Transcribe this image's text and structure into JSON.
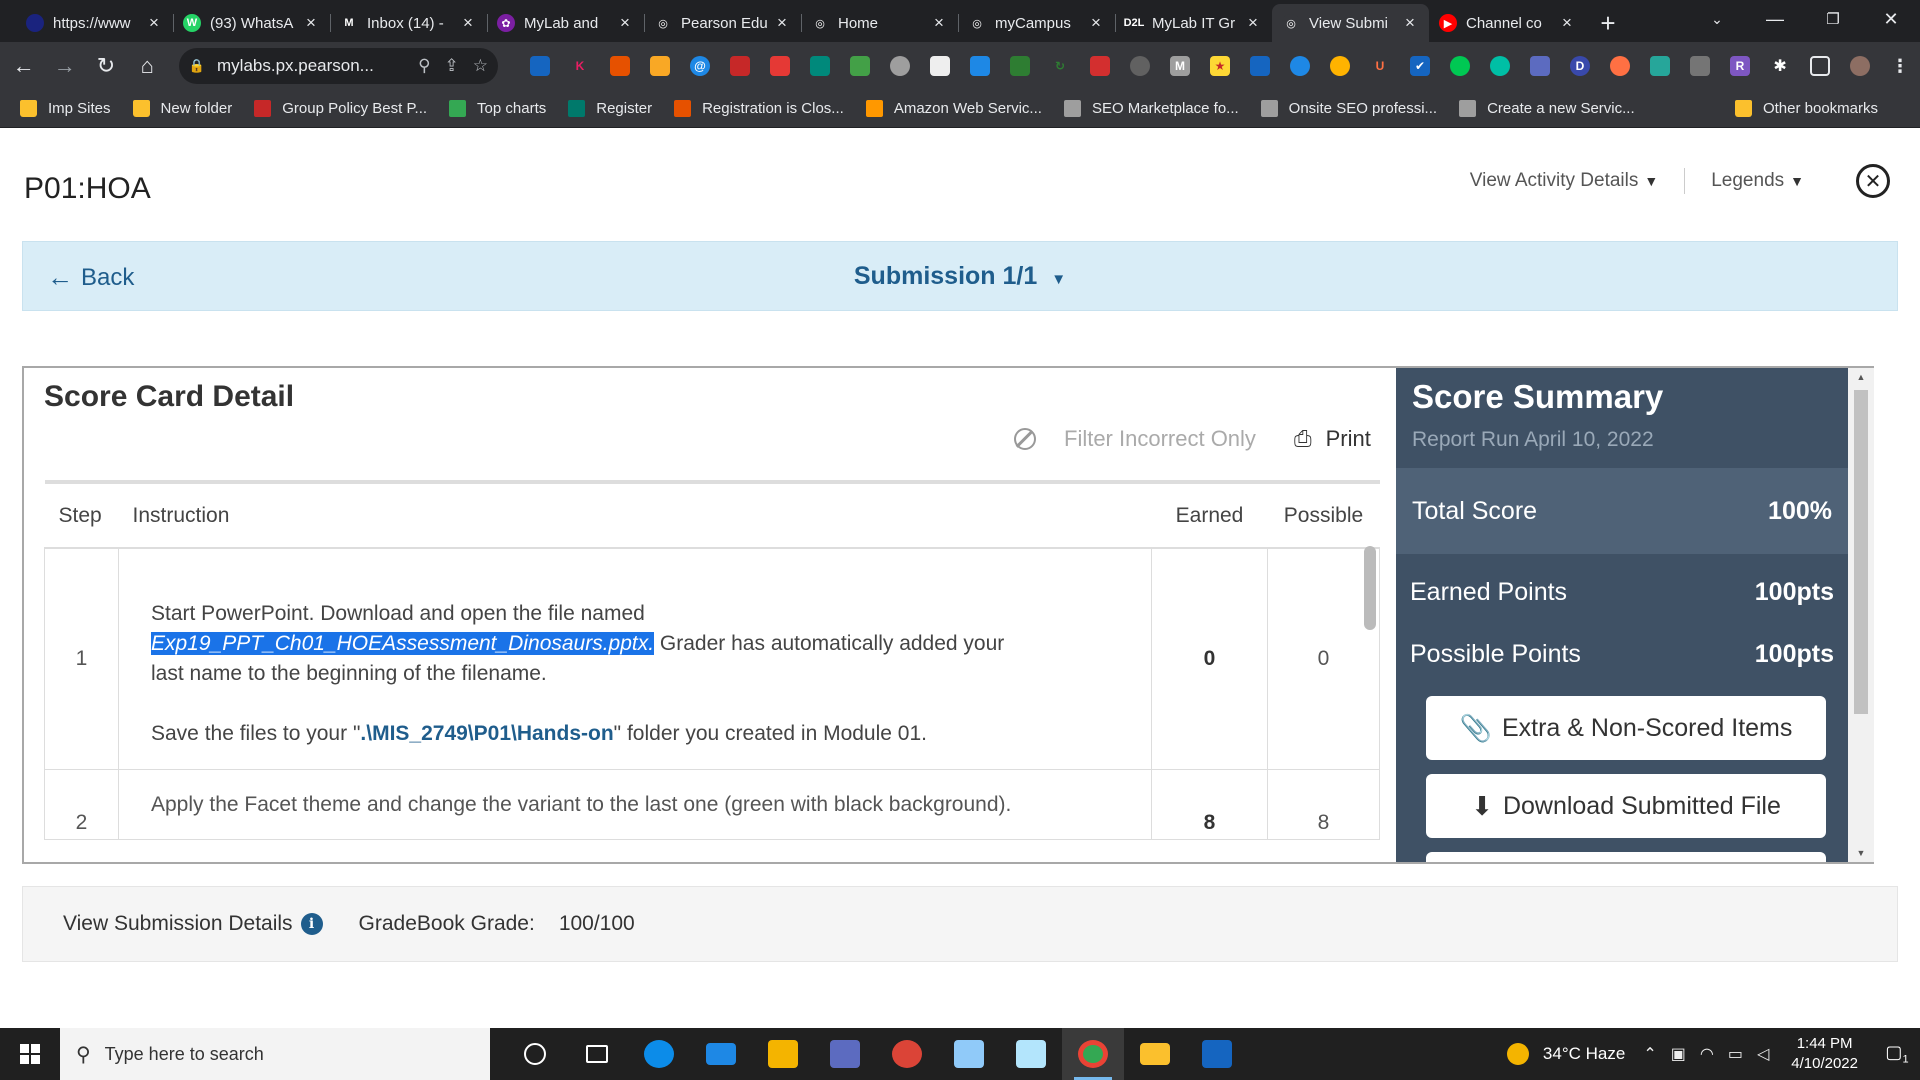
{
  "browser": {
    "tabs": [
      {
        "title": "https://www",
        "favicon_color": "#1a237e",
        "favicon": ""
      },
      {
        "title": "(93) WhatsA",
        "favicon_color": "#25d366",
        "favicon": "W"
      },
      {
        "title": "Inbox (14) -",
        "favicon_color": "#202124",
        "favicon": "M"
      },
      {
        "title": "MyLab and",
        "favicon_color": "#7b1fa2",
        "favicon": "✿"
      },
      {
        "title": "Pearson Edu",
        "favicon_color": "#202124",
        "favicon": "◎"
      },
      {
        "title": "Home",
        "favicon_color": "#202124",
        "favicon": "◎"
      },
      {
        "title": "myCampus",
        "favicon_color": "#202124",
        "favicon": "◎"
      },
      {
        "title": "MyLab IT Gr",
        "favicon_color": "#202124",
        "favicon": "D2L"
      },
      {
        "title": "View Submi",
        "favicon_color": "#35363a",
        "favicon": "◎"
      },
      {
        "title": "Channel co",
        "favicon_color": "#ff0000",
        "favicon": "▶"
      }
    ],
    "url": "mylabs.px.pearson...",
    "bookmarks": [
      {
        "label": "Imp Sites",
        "color": "#fbc02d"
      },
      {
        "label": "New folder",
        "color": "#fbc02d"
      },
      {
        "label": "Group Policy Best P...",
        "color": "#c62828"
      },
      {
        "label": "Top charts",
        "color": "#34a853"
      },
      {
        "label": "Register",
        "color": "#00796b"
      },
      {
        "label": "Registration is Clos...",
        "color": "#e65100"
      },
      {
        "label": "Amazon Web Servic...",
        "color": "#ff9800"
      },
      {
        "label": "SEO Marketplace fo...",
        "color": "#9e9e9e"
      },
      {
        "label": "Onsite SEO professi...",
        "color": "#9e9e9e"
      },
      {
        "label": "Create a new Servic...",
        "color": "#9e9e9e"
      }
    ],
    "other_bookmarks": "Other bookmarks",
    "new_tab": "+"
  },
  "page": {
    "title": "P01:HOA",
    "view_activity": "View Activity Details",
    "legends": "Legends",
    "back": "Back",
    "submission": "Submission 1/1",
    "score_card_title": "Score Card Detail",
    "filter": "Filter Incorrect Only",
    "print": "Print",
    "columns": {
      "step": "Step",
      "instruction": "Instruction",
      "earned": "Earned",
      "possible": "Possible"
    },
    "rows": [
      {
        "step": "1",
        "line1": "Start PowerPoint. Download and open the file named",
        "filename": "Exp19_PPT_Ch01_HOEAssessment_Dinosaurs.pptx.",
        "line2": " Grader has automatically added your",
        "line3": "last name to the beginning of the filename.",
        "save_pre": "Save the files to your \"",
        "save_path": ".\\MIS_2749\\P01\\Hands-on",
        "save_post": "\" folder you created in Module 01.",
        "earned": "0",
        "possible": "0"
      },
      {
        "step": "2",
        "instruction": "Apply the Facet theme and change the variant to the last one (green with black background).",
        "earned": "8",
        "possible": "8"
      }
    ],
    "summary": {
      "title": "Score Summary",
      "report_run": "Report Run April 10, 2022",
      "total_label": "Total Score",
      "total_value": "100%",
      "earned_label": "Earned Points",
      "earned_value": "100pts",
      "possible_label": "Possible Points",
      "possible_value": "100pts",
      "extra_btn": "Extra & Non-Scored Items",
      "download_btn": "Download Submitted File"
    },
    "footer": {
      "details": "View Submission Details",
      "gradebook_label": "GradeBook Grade:",
      "gradebook_value": "100/100"
    }
  },
  "taskbar": {
    "search_placeholder": "Type here to search",
    "weather": "34°C Haze",
    "time": "1:44 PM",
    "date": "4/10/2022",
    "notifications": "1"
  }
}
